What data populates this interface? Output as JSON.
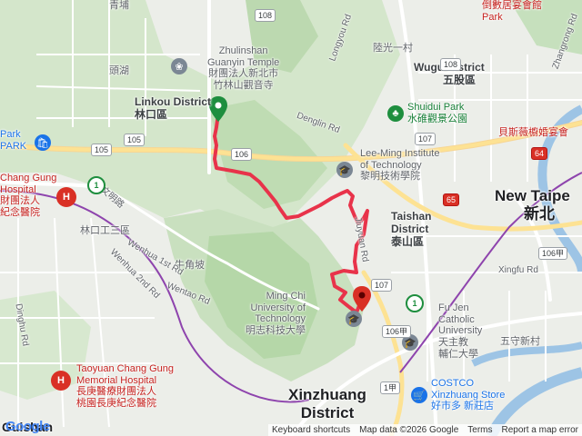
{
  "labels": {
    "linkou": "Linkou District",
    "linkou_zh": "林口區",
    "wugu": "Wugu District",
    "wugu_zh": "五股區",
    "taishan": "Taishan",
    "taishan2": "District",
    "taishan_zh": "泰山區",
    "new_taipei": "New Taipe",
    "new_taipei_zh": "新北",
    "xinzhuang": "Xinzhuang",
    "xinzhuang2": "District",
    "guishan": "Guishan",
    "zhulinshan1": "Zhulinshan",
    "zhulinshan2": "Guanyin Temple",
    "zhulinshan3": "財團法人新北市",
    "zhulinshan4": "竹林山觀音寺",
    "leeming1": "Lee-Ming Institute",
    "leeming2": "of Technology",
    "leeming3": "黎明技術學院",
    "shuidui1": "Shuidui Park",
    "shuidui2": "水碓觀景公園",
    "beisi": "貝斯薇櫥婚宴會",
    "mingchi1": "Ming Chi",
    "mingchi2": "University of",
    "mingchi3": "Technology",
    "mingchi4": "明志科技大學",
    "fujen1": "Fu Jen",
    "fujen2": "Catholic",
    "fujen3": "University",
    "fujen4": "天主教",
    "fujen5": "輔仁大學",
    "costco1": "COSTCO",
    "costco2": "Xinzhuang Store",
    "costco3": "好市多 新莊店",
    "changgung_top1": "Chang Gung",
    "changgung_top2": "Hospital",
    "changgung_top3": "財團法人",
    "changgung_top4": "紀念醫院",
    "changgung1": "Taoyuan Chang Gung",
    "changgung2": "Memorial Hospital",
    "changgung3": "長庚醫療財團法人",
    "changgung4": "桃園長庚紀念醫院",
    "park": "Park",
    "park_zh": "PARK",
    "toulu": "頭湖",
    "linkou_ind": "林口工三區",
    "niujiaopo": "牛角坡",
    "luguangyicun": "陸光一村",
    "wushou": "五守新村",
    "denglin": "Denglin Rd",
    "longyou": "Longyou Rd",
    "wenhua2": "Wenhua 2nd Rd",
    "wenhua1": "Wenhua 1st Rd",
    "wentao": "Wentao Rd",
    "dinghu": "Dinghu Rd",
    "wenming": "文明路",
    "xingfu": "Xingfu Rd",
    "zhangrong": "Zhangrong Rd",
    "jiuyuan": "Jiuyuan Rd",
    "top_left": "青埔",
    "top_right": "倒數居宴會館",
    "top_right2": "Park"
  },
  "shields": [
    "108",
    "105",
    "106",
    "105",
    "108",
    "107",
    "107",
    "106甲",
    "65",
    "64",
    "106甲",
    "1甲"
  ],
  "attribution": {
    "logo": "Google",
    "shortcuts": "Keyboard shortcuts",
    "mapdata": "Map data ©2026 Google",
    "terms": "Terms",
    "report": "Report a map error"
  },
  "colors": {
    "route": "#e8334a",
    "start_marker": "#1e8e3e",
    "end_marker": "#d93025",
    "water": "#9dc4e5",
    "park": "#c8e2c0"
  }
}
